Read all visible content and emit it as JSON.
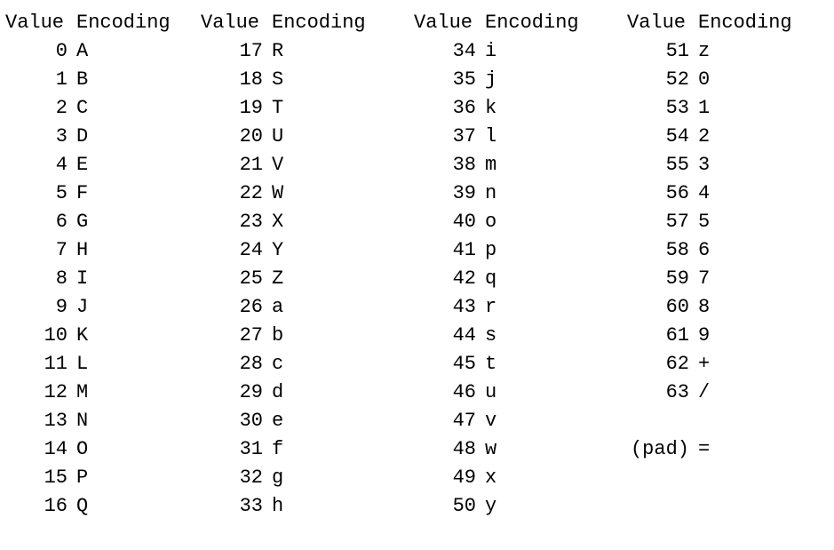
{
  "headers": {
    "value": "Value",
    "encoding": "Encoding"
  },
  "columns": [
    {
      "rows": [
        {
          "value": "0",
          "encoding": "A"
        },
        {
          "value": "1",
          "encoding": "B"
        },
        {
          "value": "2",
          "encoding": "C"
        },
        {
          "value": "3",
          "encoding": "D"
        },
        {
          "value": "4",
          "encoding": "E"
        },
        {
          "value": "5",
          "encoding": "F"
        },
        {
          "value": "6",
          "encoding": "G"
        },
        {
          "value": "7",
          "encoding": "H"
        },
        {
          "value": "8",
          "encoding": "I"
        },
        {
          "value": "9",
          "encoding": "J"
        },
        {
          "value": "10",
          "encoding": "K"
        },
        {
          "value": "11",
          "encoding": "L"
        },
        {
          "value": "12",
          "encoding": "M"
        },
        {
          "value": "13",
          "encoding": "N"
        },
        {
          "value": "14",
          "encoding": "O"
        },
        {
          "value": "15",
          "encoding": "P"
        },
        {
          "value": "16",
          "encoding": "Q"
        }
      ]
    },
    {
      "rows": [
        {
          "value": "17",
          "encoding": "R"
        },
        {
          "value": "18",
          "encoding": "S"
        },
        {
          "value": "19",
          "encoding": "T"
        },
        {
          "value": "20",
          "encoding": "U"
        },
        {
          "value": "21",
          "encoding": "V"
        },
        {
          "value": "22",
          "encoding": "W"
        },
        {
          "value": "23",
          "encoding": "X"
        },
        {
          "value": "24",
          "encoding": "Y"
        },
        {
          "value": "25",
          "encoding": "Z"
        },
        {
          "value": "26",
          "encoding": "a"
        },
        {
          "value": "27",
          "encoding": "b"
        },
        {
          "value": "28",
          "encoding": "c"
        },
        {
          "value": "29",
          "encoding": "d"
        },
        {
          "value": "30",
          "encoding": "e"
        },
        {
          "value": "31",
          "encoding": "f"
        },
        {
          "value": "32",
          "encoding": "g"
        },
        {
          "value": "33",
          "encoding": "h"
        }
      ]
    },
    {
      "rows": [
        {
          "value": "34",
          "encoding": "i"
        },
        {
          "value": "35",
          "encoding": "j"
        },
        {
          "value": "36",
          "encoding": "k"
        },
        {
          "value": "37",
          "encoding": "l"
        },
        {
          "value": "38",
          "encoding": "m"
        },
        {
          "value": "39",
          "encoding": "n"
        },
        {
          "value": "40",
          "encoding": "o"
        },
        {
          "value": "41",
          "encoding": "p"
        },
        {
          "value": "42",
          "encoding": "q"
        },
        {
          "value": "43",
          "encoding": "r"
        },
        {
          "value": "44",
          "encoding": "s"
        },
        {
          "value": "45",
          "encoding": "t"
        },
        {
          "value": "46",
          "encoding": "u"
        },
        {
          "value": "47",
          "encoding": "v"
        },
        {
          "value": "48",
          "encoding": "w"
        },
        {
          "value": "49",
          "encoding": "x"
        },
        {
          "value": "50",
          "encoding": "y"
        }
      ]
    },
    {
      "rows": [
        {
          "value": "51",
          "encoding": "z"
        },
        {
          "value": "52",
          "encoding": "0"
        },
        {
          "value": "53",
          "encoding": "1"
        },
        {
          "value": "54",
          "encoding": "2"
        },
        {
          "value": "55",
          "encoding": "3"
        },
        {
          "value": "56",
          "encoding": "4"
        },
        {
          "value": "57",
          "encoding": "5"
        },
        {
          "value": "58",
          "encoding": "6"
        },
        {
          "value": "59",
          "encoding": "7"
        },
        {
          "value": "60",
          "encoding": "8"
        },
        {
          "value": "61",
          "encoding": "9"
        },
        {
          "value": "62",
          "encoding": "+"
        },
        {
          "value": "63",
          "encoding": "/"
        }
      ]
    }
  ],
  "pad": {
    "label": "(pad)",
    "encoding": "="
  }
}
